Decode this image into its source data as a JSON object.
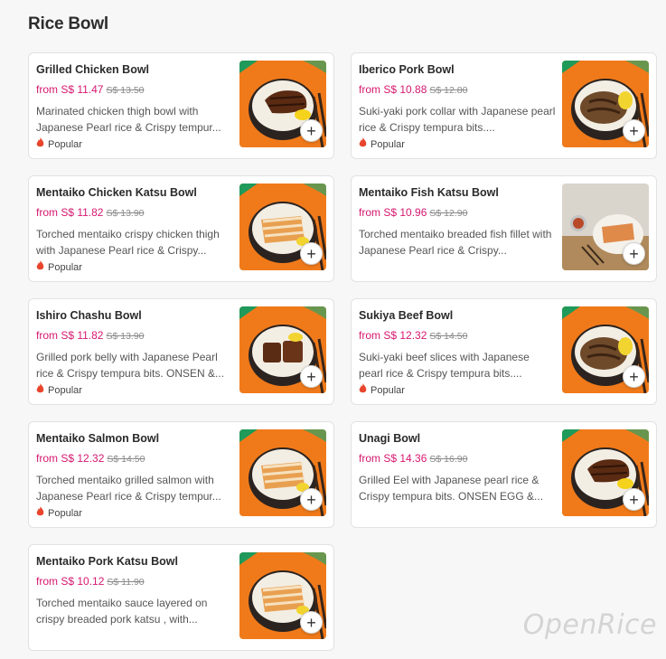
{
  "section": {
    "title": "Rice Bowl"
  },
  "popular_label": "Popular",
  "items": [
    {
      "name": "Grilled Chicken Bowl",
      "price": "from S$ 11.47",
      "old_price": "S$ 13.50",
      "desc": "Marinated chicken thigh bowl with Japanese Pearl rice & Crispy tempur...",
      "popular": true,
      "image": "chicken"
    },
    {
      "name": "Iberico Pork Bowl",
      "price": "from S$ 10.88",
      "old_price": "S$ 12.80",
      "desc": "Suki-yaki pork collar with Japanese pearl rice & Crispy tempura bits....",
      "popular": true,
      "image": "pork"
    },
    {
      "name": "Mentaiko Chicken Katsu Bowl",
      "price": "from S$ 11.82",
      "old_price": "S$ 13.90",
      "desc": "Torched mentaiko crispy chicken thigh with Japanese Pearl rice & Crispy...",
      "popular": true,
      "image": "katsu"
    },
    {
      "name": "Mentaiko Fish Katsu Bowl",
      "price": "from S$ 10.96",
      "old_price": "S$ 12.90",
      "desc": "Torched mentaiko breaded fish fillet with Japanese Pearl rice & Crispy...",
      "popular": false,
      "image": "fish"
    },
    {
      "name": "Ishiro Chashu Bowl",
      "price": "from S$ 11.82",
      "old_price": "S$ 13.90",
      "desc": "Grilled pork belly with Japanese Pearl rice & Crispy tempura bits. ONSEN &...",
      "popular": true,
      "image": "chashu"
    },
    {
      "name": "Sukiya Beef Bowl",
      "price": "from S$ 12.32",
      "old_price": "S$ 14.50",
      "desc": "Suki-yaki beef slices with Japanese pearl rice & Crispy tempura bits....",
      "popular": true,
      "image": "beef"
    },
    {
      "name": "Mentaiko Salmon Bowl",
      "price": "from S$ 12.32",
      "old_price": "S$ 14.50",
      "desc": "Torched mentaiko grilled salmon with Japanese Pearl rice & Crispy tempur...",
      "popular": true,
      "image": "salmon"
    },
    {
      "name": "Unagi Bowl",
      "price": "from S$ 14.36",
      "old_price": "S$ 16.90",
      "desc": "Grilled Eel with Japanese pearl rice & Crispy tempura bits. ONSEN EGG &...",
      "popular": false,
      "image": "unagi"
    },
    {
      "name": "Mentaiko Pork Katsu Bowl",
      "price": "from S$ 10.12",
      "old_price": "S$ 11.90",
      "desc": "Torched mentaiko sauce layered on crispy breaded pork katsu , with...",
      "popular": false,
      "image": "porkkatsu"
    }
  ],
  "add_label": "+",
  "watermark": "OpenRice",
  "colors": {
    "price": "#d6186f",
    "thumb_bg": "#f07a1a",
    "thumb_corner": "#1f9a5a",
    "flame": "#e8452c"
  }
}
